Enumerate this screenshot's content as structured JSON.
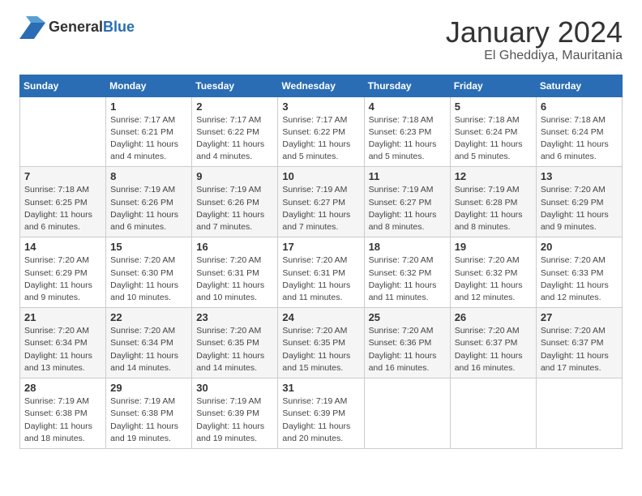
{
  "logo": {
    "general": "General",
    "blue": "Blue"
  },
  "title": "January 2024",
  "location": "El Gheddiya, Mauritania",
  "weekdays": [
    "Sunday",
    "Monday",
    "Tuesday",
    "Wednesday",
    "Thursday",
    "Friday",
    "Saturday"
  ],
  "weeks": [
    [
      {
        "day": "",
        "details": ""
      },
      {
        "day": "1",
        "details": "Sunrise: 7:17 AM\nSunset: 6:21 PM\nDaylight: 11 hours\nand 4 minutes."
      },
      {
        "day": "2",
        "details": "Sunrise: 7:17 AM\nSunset: 6:22 PM\nDaylight: 11 hours\nand 4 minutes."
      },
      {
        "day": "3",
        "details": "Sunrise: 7:17 AM\nSunset: 6:22 PM\nDaylight: 11 hours\nand 5 minutes."
      },
      {
        "day": "4",
        "details": "Sunrise: 7:18 AM\nSunset: 6:23 PM\nDaylight: 11 hours\nand 5 minutes."
      },
      {
        "day": "5",
        "details": "Sunrise: 7:18 AM\nSunset: 6:24 PM\nDaylight: 11 hours\nand 5 minutes."
      },
      {
        "day": "6",
        "details": "Sunrise: 7:18 AM\nSunset: 6:24 PM\nDaylight: 11 hours\nand 6 minutes."
      }
    ],
    [
      {
        "day": "7",
        "details": "Sunrise: 7:18 AM\nSunset: 6:25 PM\nDaylight: 11 hours\nand 6 minutes."
      },
      {
        "day": "8",
        "details": "Sunrise: 7:19 AM\nSunset: 6:26 PM\nDaylight: 11 hours\nand 6 minutes."
      },
      {
        "day": "9",
        "details": "Sunrise: 7:19 AM\nSunset: 6:26 PM\nDaylight: 11 hours\nand 7 minutes."
      },
      {
        "day": "10",
        "details": "Sunrise: 7:19 AM\nSunset: 6:27 PM\nDaylight: 11 hours\nand 7 minutes."
      },
      {
        "day": "11",
        "details": "Sunrise: 7:19 AM\nSunset: 6:27 PM\nDaylight: 11 hours\nand 8 minutes."
      },
      {
        "day": "12",
        "details": "Sunrise: 7:19 AM\nSunset: 6:28 PM\nDaylight: 11 hours\nand 8 minutes."
      },
      {
        "day": "13",
        "details": "Sunrise: 7:20 AM\nSunset: 6:29 PM\nDaylight: 11 hours\nand 9 minutes."
      }
    ],
    [
      {
        "day": "14",
        "details": "Sunrise: 7:20 AM\nSunset: 6:29 PM\nDaylight: 11 hours\nand 9 minutes."
      },
      {
        "day": "15",
        "details": "Sunrise: 7:20 AM\nSunset: 6:30 PM\nDaylight: 11 hours\nand 10 minutes."
      },
      {
        "day": "16",
        "details": "Sunrise: 7:20 AM\nSunset: 6:31 PM\nDaylight: 11 hours\nand 10 minutes."
      },
      {
        "day": "17",
        "details": "Sunrise: 7:20 AM\nSunset: 6:31 PM\nDaylight: 11 hours\nand 11 minutes."
      },
      {
        "day": "18",
        "details": "Sunrise: 7:20 AM\nSunset: 6:32 PM\nDaylight: 11 hours\nand 11 minutes."
      },
      {
        "day": "19",
        "details": "Sunrise: 7:20 AM\nSunset: 6:32 PM\nDaylight: 11 hours\nand 12 minutes."
      },
      {
        "day": "20",
        "details": "Sunrise: 7:20 AM\nSunset: 6:33 PM\nDaylight: 11 hours\nand 12 minutes."
      }
    ],
    [
      {
        "day": "21",
        "details": "Sunrise: 7:20 AM\nSunset: 6:34 PM\nDaylight: 11 hours\nand 13 minutes."
      },
      {
        "day": "22",
        "details": "Sunrise: 7:20 AM\nSunset: 6:34 PM\nDaylight: 11 hours\nand 14 minutes."
      },
      {
        "day": "23",
        "details": "Sunrise: 7:20 AM\nSunset: 6:35 PM\nDaylight: 11 hours\nand 14 minutes."
      },
      {
        "day": "24",
        "details": "Sunrise: 7:20 AM\nSunset: 6:35 PM\nDaylight: 11 hours\nand 15 minutes."
      },
      {
        "day": "25",
        "details": "Sunrise: 7:20 AM\nSunset: 6:36 PM\nDaylight: 11 hours\nand 16 minutes."
      },
      {
        "day": "26",
        "details": "Sunrise: 7:20 AM\nSunset: 6:37 PM\nDaylight: 11 hours\nand 16 minutes."
      },
      {
        "day": "27",
        "details": "Sunrise: 7:20 AM\nSunset: 6:37 PM\nDaylight: 11 hours\nand 17 minutes."
      }
    ],
    [
      {
        "day": "28",
        "details": "Sunrise: 7:19 AM\nSunset: 6:38 PM\nDaylight: 11 hours\nand 18 minutes."
      },
      {
        "day": "29",
        "details": "Sunrise: 7:19 AM\nSunset: 6:38 PM\nDaylight: 11 hours\nand 19 minutes."
      },
      {
        "day": "30",
        "details": "Sunrise: 7:19 AM\nSunset: 6:39 PM\nDaylight: 11 hours\nand 19 minutes."
      },
      {
        "day": "31",
        "details": "Sunrise: 7:19 AM\nSunset: 6:39 PM\nDaylight: 11 hours\nand 20 minutes."
      },
      {
        "day": "",
        "details": ""
      },
      {
        "day": "",
        "details": ""
      },
      {
        "day": "",
        "details": ""
      }
    ]
  ]
}
